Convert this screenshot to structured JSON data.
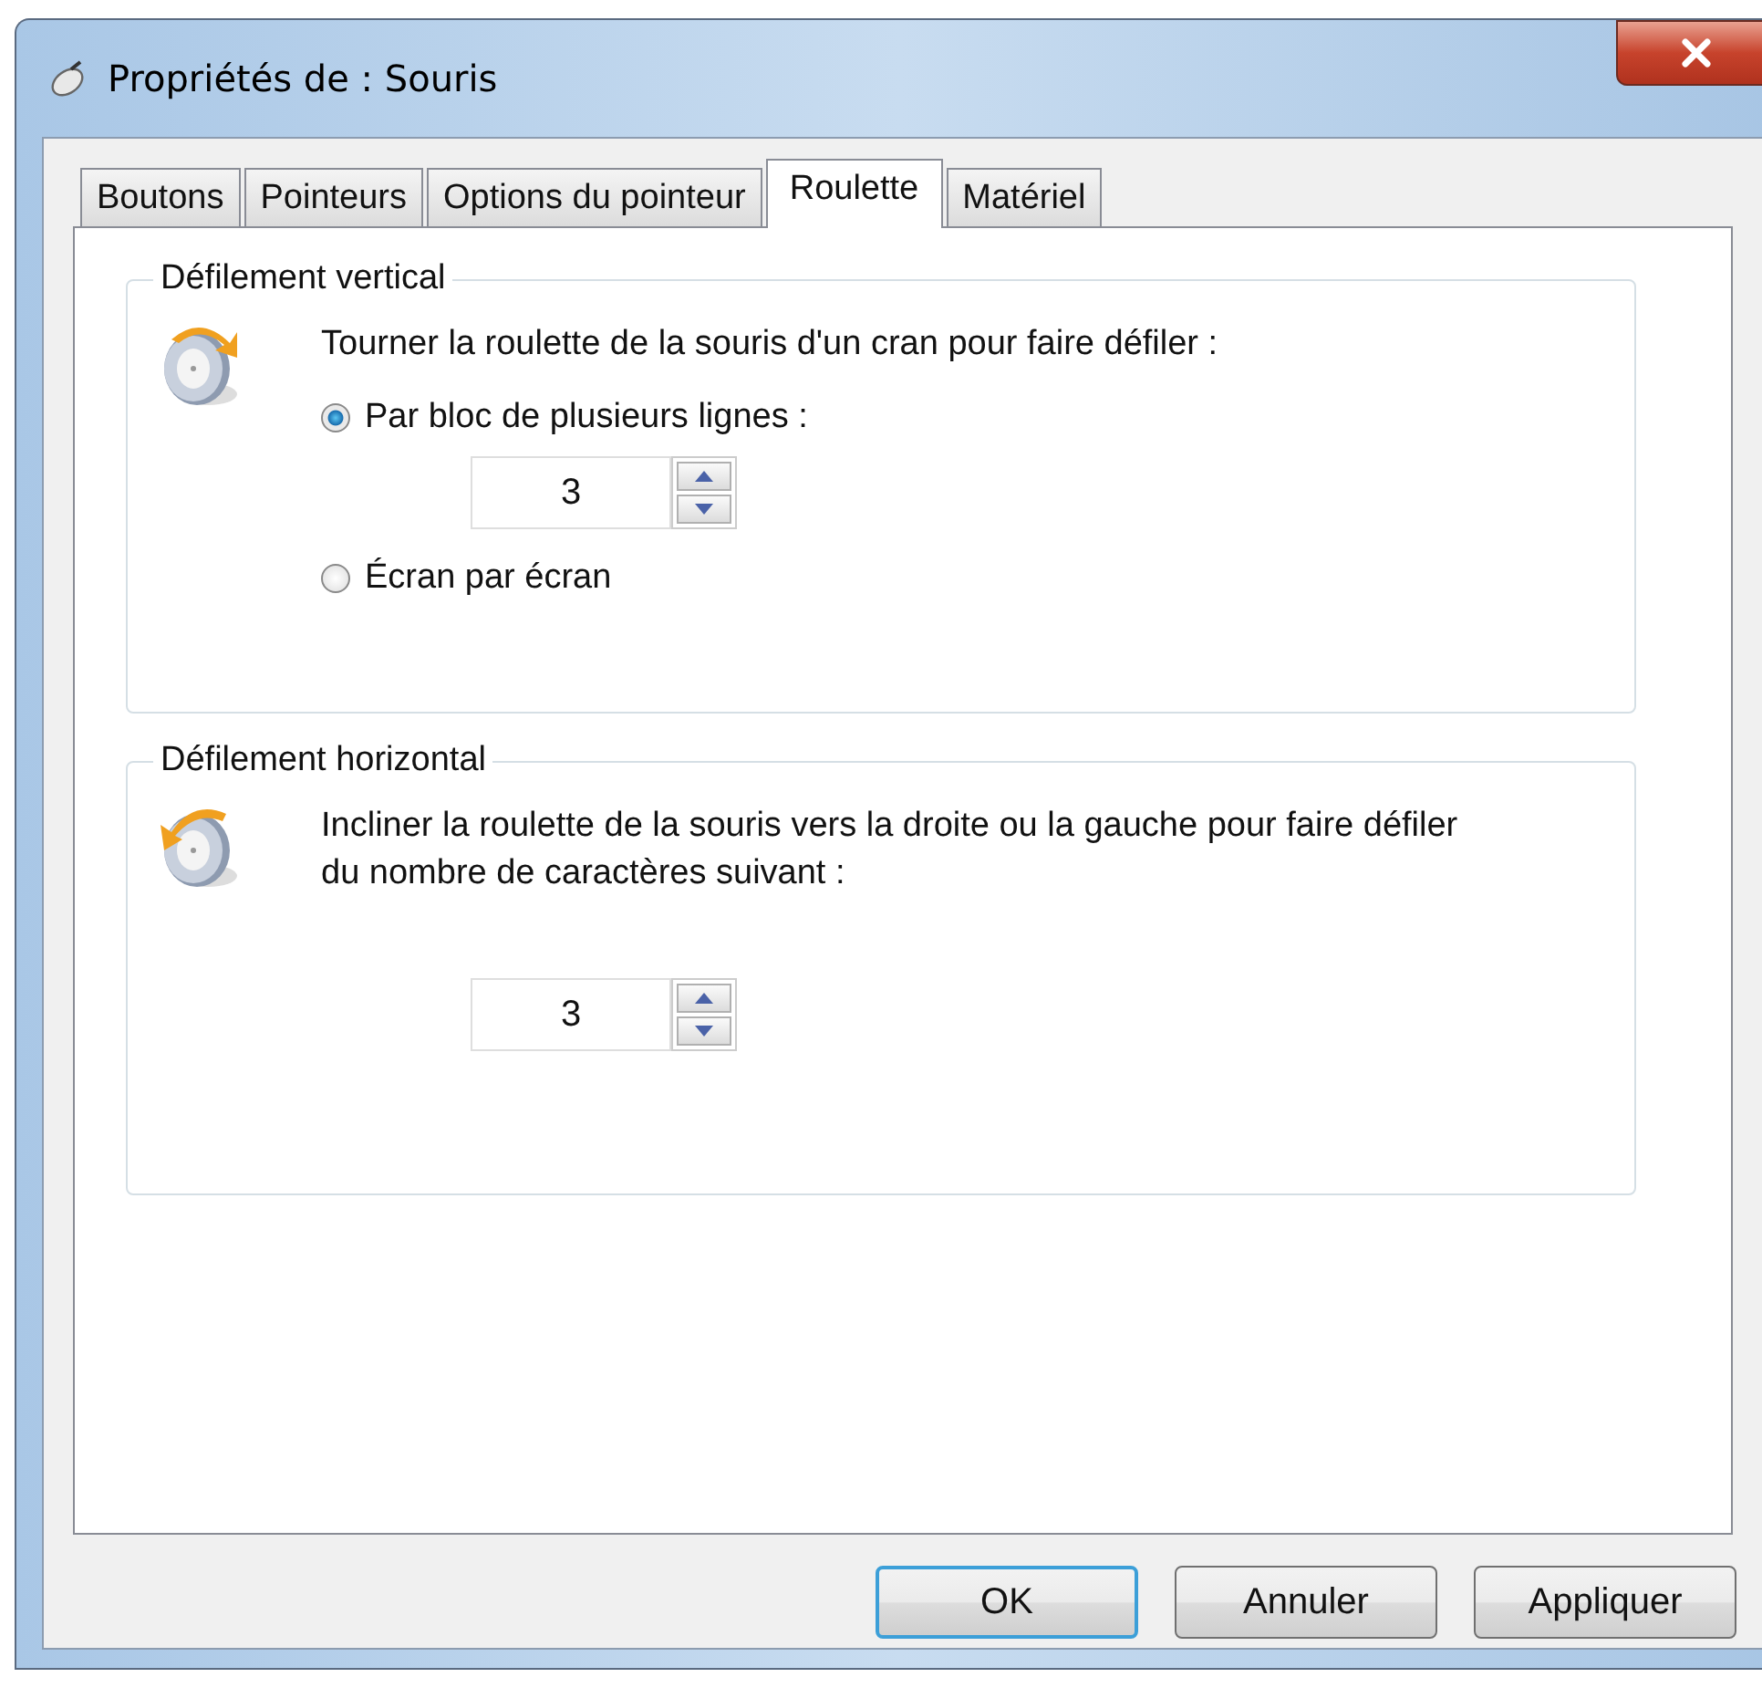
{
  "window": {
    "title": "Propriétés de : Souris"
  },
  "tabs": [
    {
      "label": "Boutons",
      "selected": false
    },
    {
      "label": "Pointeurs",
      "selected": false
    },
    {
      "label": "Options du pointeur",
      "selected": false
    },
    {
      "label": "Roulette",
      "selected": true
    },
    {
      "label": "Matériel",
      "selected": false
    }
  ],
  "groups": [
    {
      "title": "Défilement vertical",
      "description": "Tourner la roulette de la souris d'un cran pour faire défiler :",
      "items": [
        {
          "kind": "radio",
          "label": "Par bloc de plusieurs lignes :",
          "selected": true
        },
        {
          "kind": "spinner",
          "value": "3"
        },
        {
          "kind": "radio",
          "label": "Écran par écran",
          "selected": false
        }
      ]
    },
    {
      "title": "Défilement horizontal",
      "description": "Incliner la roulette de la souris vers la droite ou la gauche pour faire défiler du nombre de caractères suivant :",
      "items": [
        {
          "kind": "spinner",
          "value": "3"
        }
      ]
    }
  ],
  "buttons": [
    {
      "label": "OK",
      "default": true
    },
    {
      "label": "Annuler",
      "default": false
    },
    {
      "label": "Appliquer",
      "default": false
    }
  ]
}
